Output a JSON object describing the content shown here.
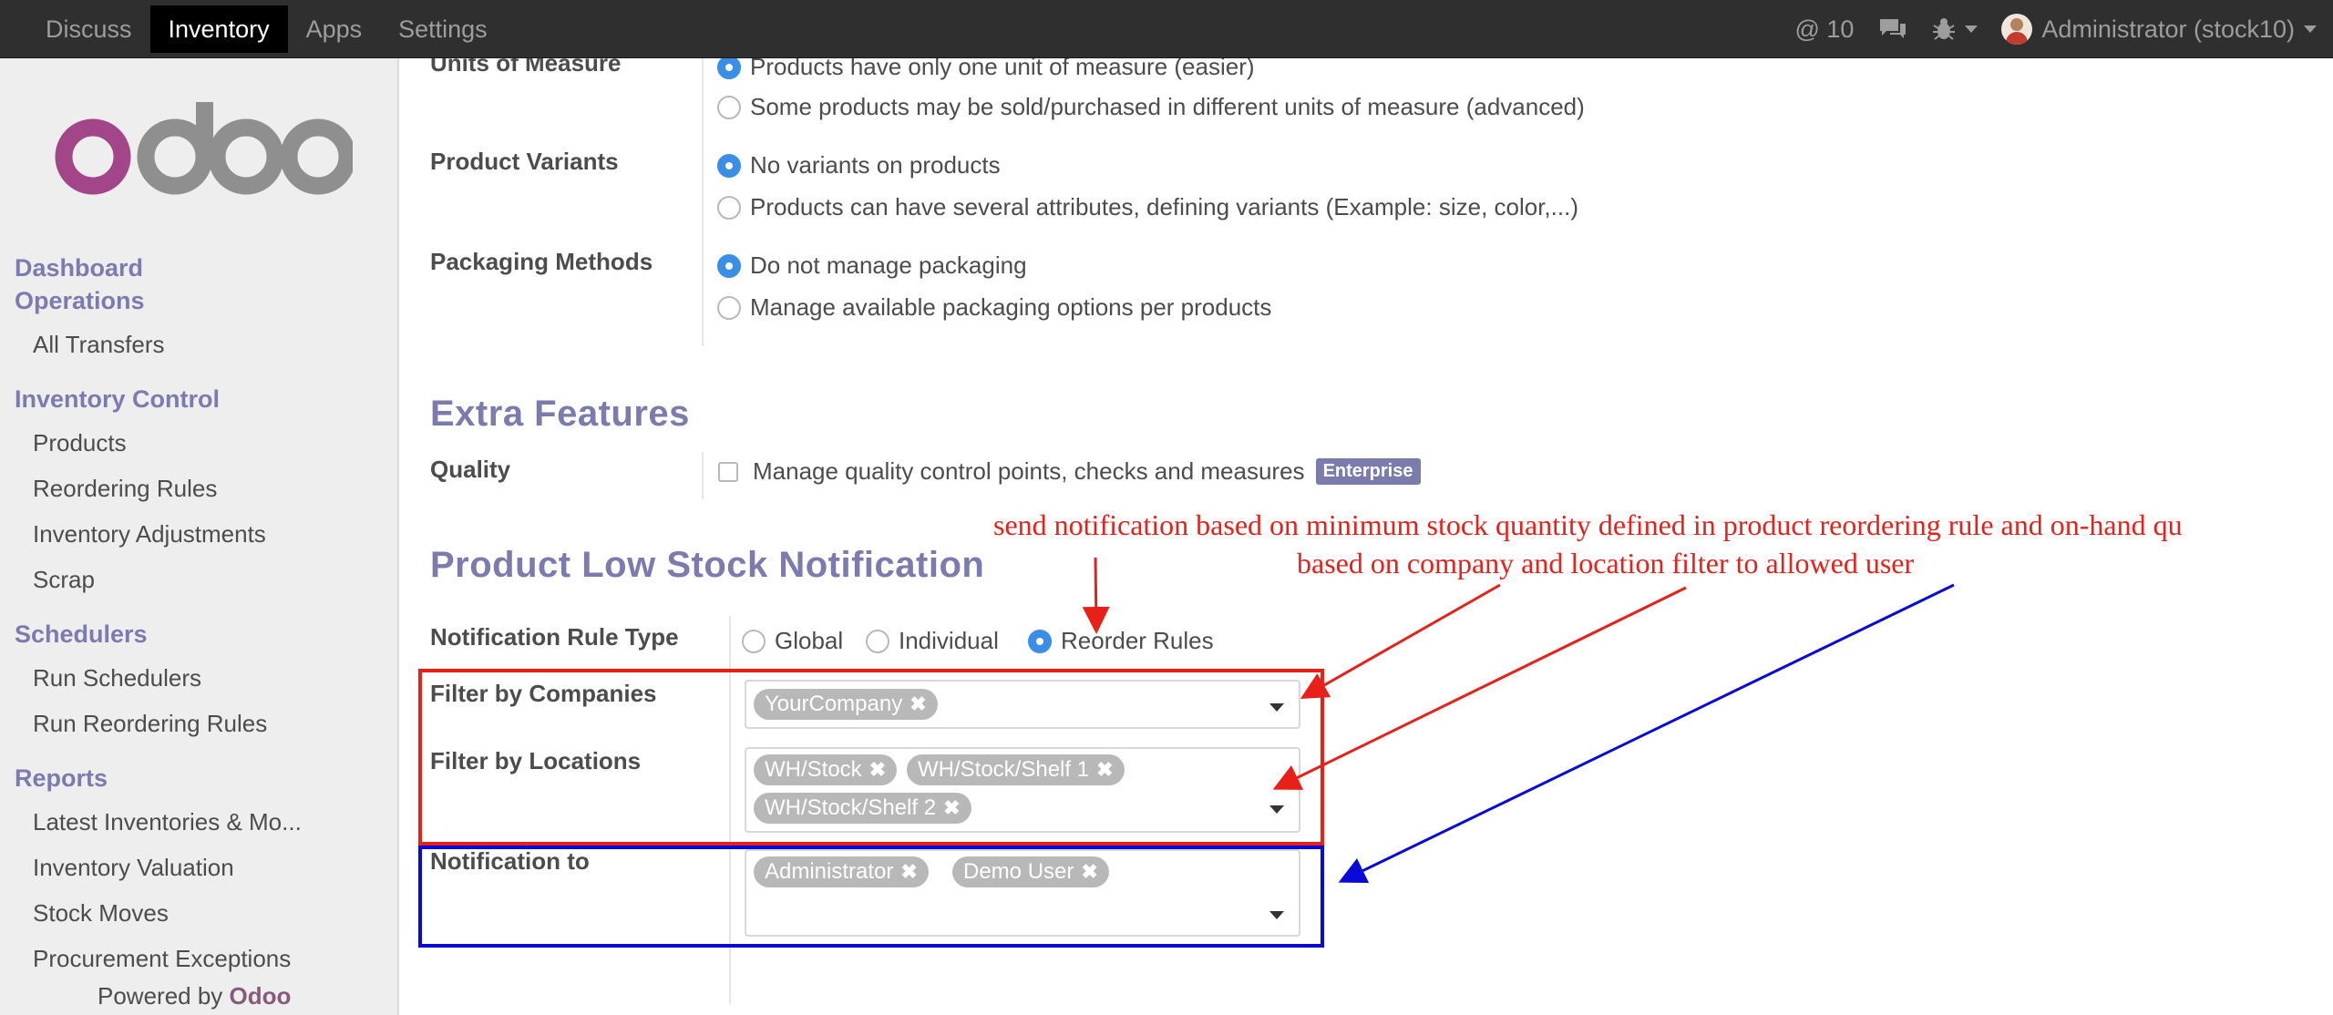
{
  "navbar": {
    "items": [
      {
        "label": "Discuss"
      },
      {
        "label": "Inventory"
      },
      {
        "label": "Apps"
      },
      {
        "label": "Settings"
      }
    ],
    "mentions": "@ 10",
    "user": "Administrator (stock10)"
  },
  "sidebar": {
    "logo_text": "odoo",
    "dashboard": "Dashboard",
    "operations": "Operations",
    "all_transfers": "All Transfers",
    "inventory_control": "Inventory Control",
    "products": "Products",
    "reordering_rules": "Reordering Rules",
    "inventory_adjustments": "Inventory Adjustments",
    "scrap": "Scrap",
    "schedulers": "Schedulers",
    "run_schedulers": "Run Schedulers",
    "run_reordering_rules": "Run Reordering Rules",
    "reports": "Reports",
    "latest_inventories": "Latest Inventories & Mo...",
    "inventory_valuation": "Inventory Valuation",
    "stock_moves": "Stock Moves",
    "procurement_exceptions": "Procurement Exceptions",
    "powered_by": "Powered by",
    "powered_brand": "Odoo"
  },
  "settings": {
    "uom_label": "Units of Measure",
    "uom_opt1": "Products have only one unit of measure (easier)",
    "uom_opt2": "Some products may be sold/purchased in different units of measure (advanced)",
    "variants_label": "Product Variants",
    "variants_opt1": "No variants on products",
    "variants_opt2": "Products can have several attributes, defining variants (Example: size, color,...)",
    "packaging_label": "Packaging Methods",
    "packaging_opt1": "Do not manage packaging",
    "packaging_opt2": "Manage available packaging options per products"
  },
  "extra": {
    "title": "Extra Features",
    "quality_label": "Quality",
    "quality_text": "Manage quality control points, checks and measures",
    "enterprise_badge": "Enterprise"
  },
  "low_stock": {
    "title": "Product Low Stock Notification",
    "rule_type_label": "Notification Rule Type",
    "rule_global": "Global",
    "rule_individual": "Individual",
    "rule_reorder": "Reorder Rules",
    "companies_label": "Filter by Companies",
    "companies": [
      "YourCompany"
    ],
    "locations_label": "Filter by Locations",
    "locations": [
      "WH/Stock",
      "WH/Stock/Shelf 1",
      "WH/Stock/Shelf 2"
    ],
    "notify_label": "Notification to",
    "notify_users": [
      "Administrator",
      "Demo User"
    ]
  },
  "annotation": {
    "line1": "send notification based on minimum stock quantity defined in product reordering rule and on-hand qu",
    "line2": "based on company and location filter to allowed user"
  },
  "colors": {
    "accent": "#7c7bad",
    "radio_active": "#3a8ee6",
    "annotation_red": "#e8201a",
    "annotation_blue": "#0a0ad8"
  }
}
